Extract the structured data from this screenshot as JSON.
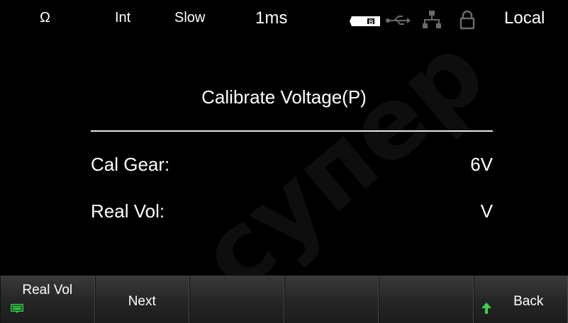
{
  "status_bar": {
    "ohm_symbol": "Ω",
    "trigger": "Int",
    "speed": "Slow",
    "interval": "1ms",
    "battery_icon": "battery-icon",
    "usb_icon": "usb-icon",
    "lan_icon": "lan-icon",
    "lock_icon": "lock-icon",
    "mode": "Local"
  },
  "dialog": {
    "title": "Calibrate Voltage(P)",
    "rows": [
      {
        "label": "Cal Gear:",
        "value": "6V"
      },
      {
        "label": "Real Vol:",
        "value": "V"
      }
    ]
  },
  "softkeys": [
    {
      "label": "Real Vol",
      "icon": "keyboard-icon"
    },
    {
      "label": "Next"
    },
    {
      "label": ""
    },
    {
      "label": ""
    },
    {
      "label": ""
    },
    {
      "label": "Back",
      "icon": "up-arrow-icon"
    }
  ],
  "watermark": "супер",
  "colors": {
    "background": "#000000",
    "text": "#ffffff",
    "accent_green": "#3fd14a"
  }
}
